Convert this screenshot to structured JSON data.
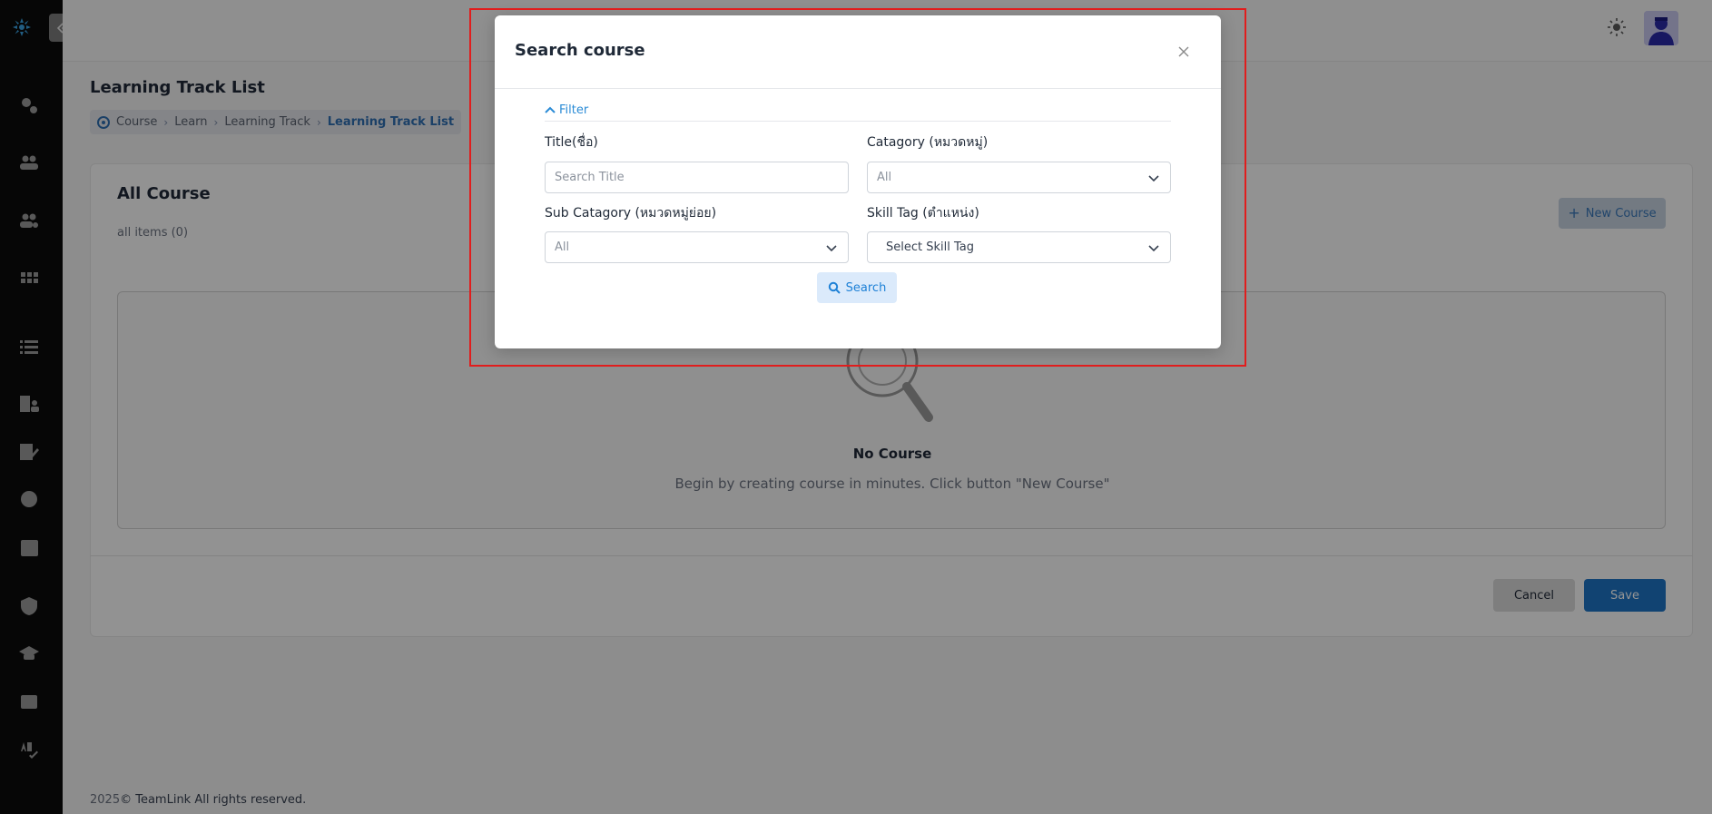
{
  "header": {
    "page_title": "Learning Track List",
    "breadcrumb": [
      "Course",
      "Learn",
      "Learning Track",
      "Learning Track List"
    ]
  },
  "card": {
    "title": "All Course",
    "count": "all items (0)",
    "new_course_label": "New Course",
    "empty_title": "No Course",
    "empty_subtitle": "Begin by creating course in minutes. Click button \"New Course\"",
    "cancel_label": "Cancel",
    "save_label": "Save"
  },
  "footer": {
    "year": "2025",
    "text": "© TeamLink All rights reserved."
  },
  "modal": {
    "title": "Search course",
    "filter_label": "Filter",
    "fields": {
      "title_label": "Title(ชื่อ)",
      "title_placeholder": "Search Title",
      "category_label": "Catagory (หมวดหมู่)",
      "category_value": "All",
      "subcategory_label": "Sub Catagory (หมวดหมู่ย่อย)",
      "subcategory_value": "All",
      "skilltag_label": "Skill Tag (ตำแหน่ง)",
      "skilltag_value": "Select Skill Tag"
    },
    "search_label": "Search"
  },
  "colors": {
    "accent": "#1e74c4",
    "highlight_border": "#e11d1d",
    "sidebar_bg": "#0b0b0b"
  },
  "icons": [
    "logo-icon",
    "settings-cogs-icon",
    "users-icon",
    "user-settings-icon",
    "apps-grid-icon",
    "list-icon",
    "building-users-icon",
    "edit-document-icon",
    "badge-icon",
    "newspaper-icon",
    "shield-icon",
    "graduation-cap-icon",
    "wallet-icon",
    "spellcheck-icon",
    "sun-icon",
    "close-icon",
    "chevron-up-icon",
    "chevron-down-icon",
    "search-icon",
    "plus-icon"
  ]
}
